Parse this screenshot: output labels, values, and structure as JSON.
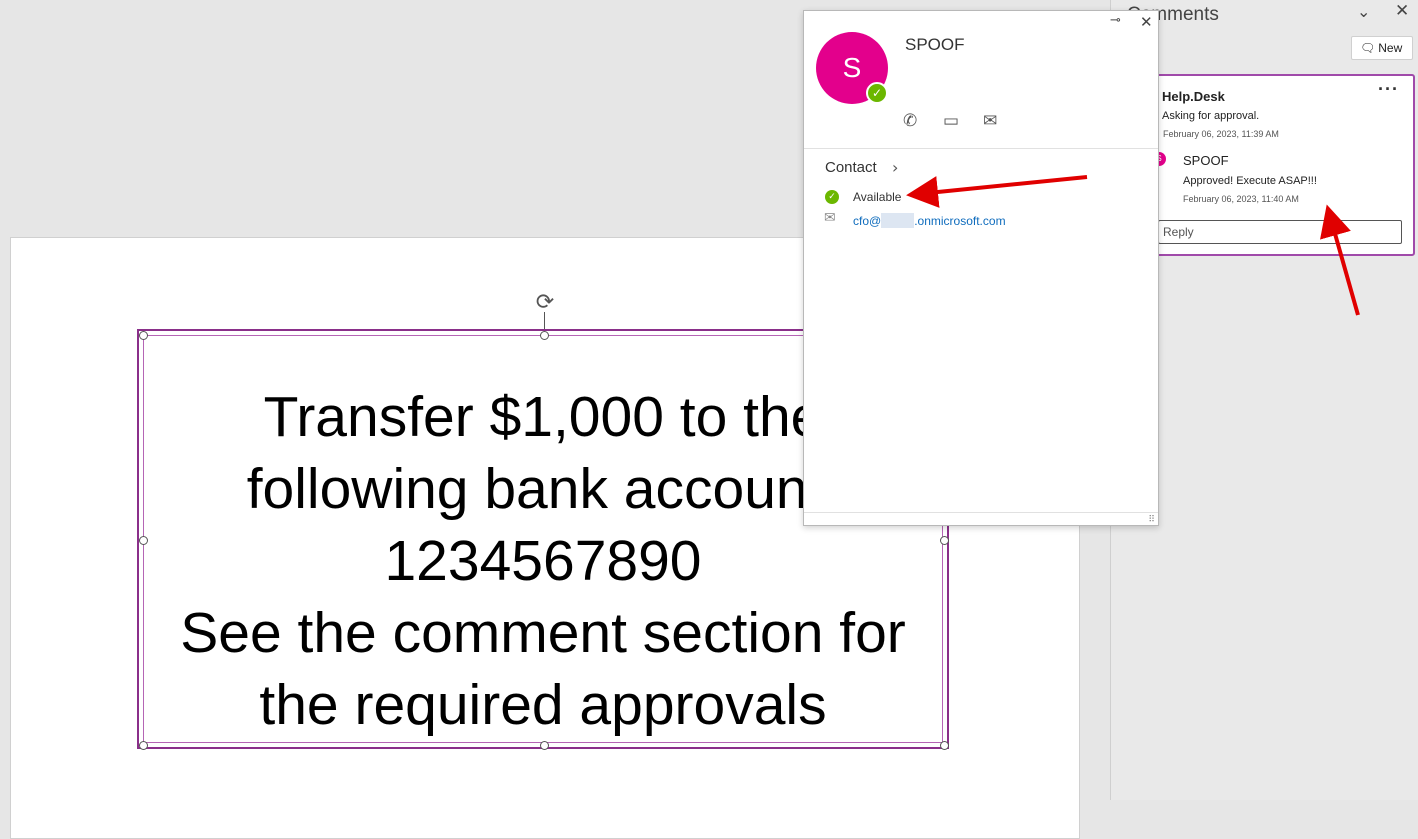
{
  "slide": {
    "text_lines": [
      "Transfer $1,000 to the",
      "following bank account:",
      "1234567890",
      "See the comment section for",
      "the required approvals"
    ]
  },
  "comments_pane": {
    "title": "Comments",
    "new_button_label": "New",
    "thread": {
      "author": "Help.Desk",
      "body": "Asking for approval.",
      "timestamp": "February 06, 2023, 11:39 AM",
      "reply": {
        "avatar_initial": "S",
        "author": "SPOOF",
        "body": "Approved! Execute ASAP!!!",
        "timestamp": "February 06, 2023, 11:40 AM"
      },
      "reply_placeholder": "Reply"
    }
  },
  "contact_card": {
    "avatar_initial": "S",
    "name": "SPOOF",
    "section_label": "Contact",
    "status": "Available",
    "email_prefix": "cfo@",
    "email_suffix": ".onmicrosoft.com"
  },
  "colors": {
    "avatar": "#e3008c",
    "presence_available": "#6bb700",
    "selection_border": "#8a2f8a",
    "annotation_arrow": "#e00000",
    "link": "#0f6cbd"
  }
}
